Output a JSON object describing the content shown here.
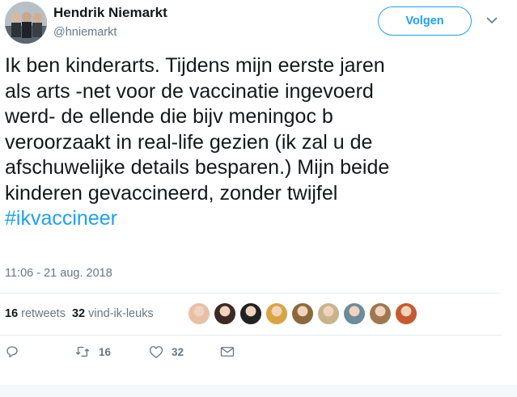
{
  "author": {
    "name": "Hendrik Niemarkt",
    "handle": "@hniemarkt",
    "avatar_icon": "user-avatar-group-photo"
  },
  "header": {
    "follow_label": "Volgen",
    "menu_icon": "chevron-down-icon"
  },
  "tweet": {
    "lines": [
      "Ik ben kinderarts. Tijdens mijn eerste jaren",
      "als arts -net voor de vaccinatie ingevoerd",
      "werd- de ellende die bijv meningoc b",
      "veroorzaakt in real-life gezien (ik zal u de",
      "afschuwelijke details besparen.) Mijn beide",
      "kinderen gevaccineerd, zonder twijfel"
    ],
    "hashtag": "#ikvaccineer",
    "timestamp": "11:06 - 21 aug. 2018"
  },
  "stats": {
    "retweets_count": "16",
    "retweets_label": "retweets",
    "likes_count": "32",
    "likes_label": "vind-ik-leuks"
  },
  "likers": [
    {
      "name": "liker-avatar-1",
      "color": "#e8c0a8"
    },
    {
      "name": "liker-avatar-2",
      "color": "#3b2a24"
    },
    {
      "name": "liker-avatar-3",
      "color": "#222222"
    },
    {
      "name": "liker-avatar-4",
      "color": "#d9a441"
    },
    {
      "name": "liker-avatar-5",
      "color": "#8a6a3c"
    },
    {
      "name": "liker-avatar-6",
      "color": "#c8b48c"
    },
    {
      "name": "liker-avatar-7",
      "color": "#6b8c9a"
    },
    {
      "name": "liker-avatar-8",
      "color": "#a07850"
    },
    {
      "name": "liker-avatar-9",
      "color": "#c65a2e"
    }
  ],
  "actions": {
    "reply_icon": "reply-icon",
    "retweet_icon": "retweet-icon",
    "retweet_count": "16",
    "like_icon": "heart-icon",
    "like_count": "32",
    "dm_icon": "envelope-icon"
  },
  "colors": {
    "accent": "#1da1f2",
    "text": "#14171a",
    "muted": "#657786",
    "divider": "#e6ecf0"
  }
}
